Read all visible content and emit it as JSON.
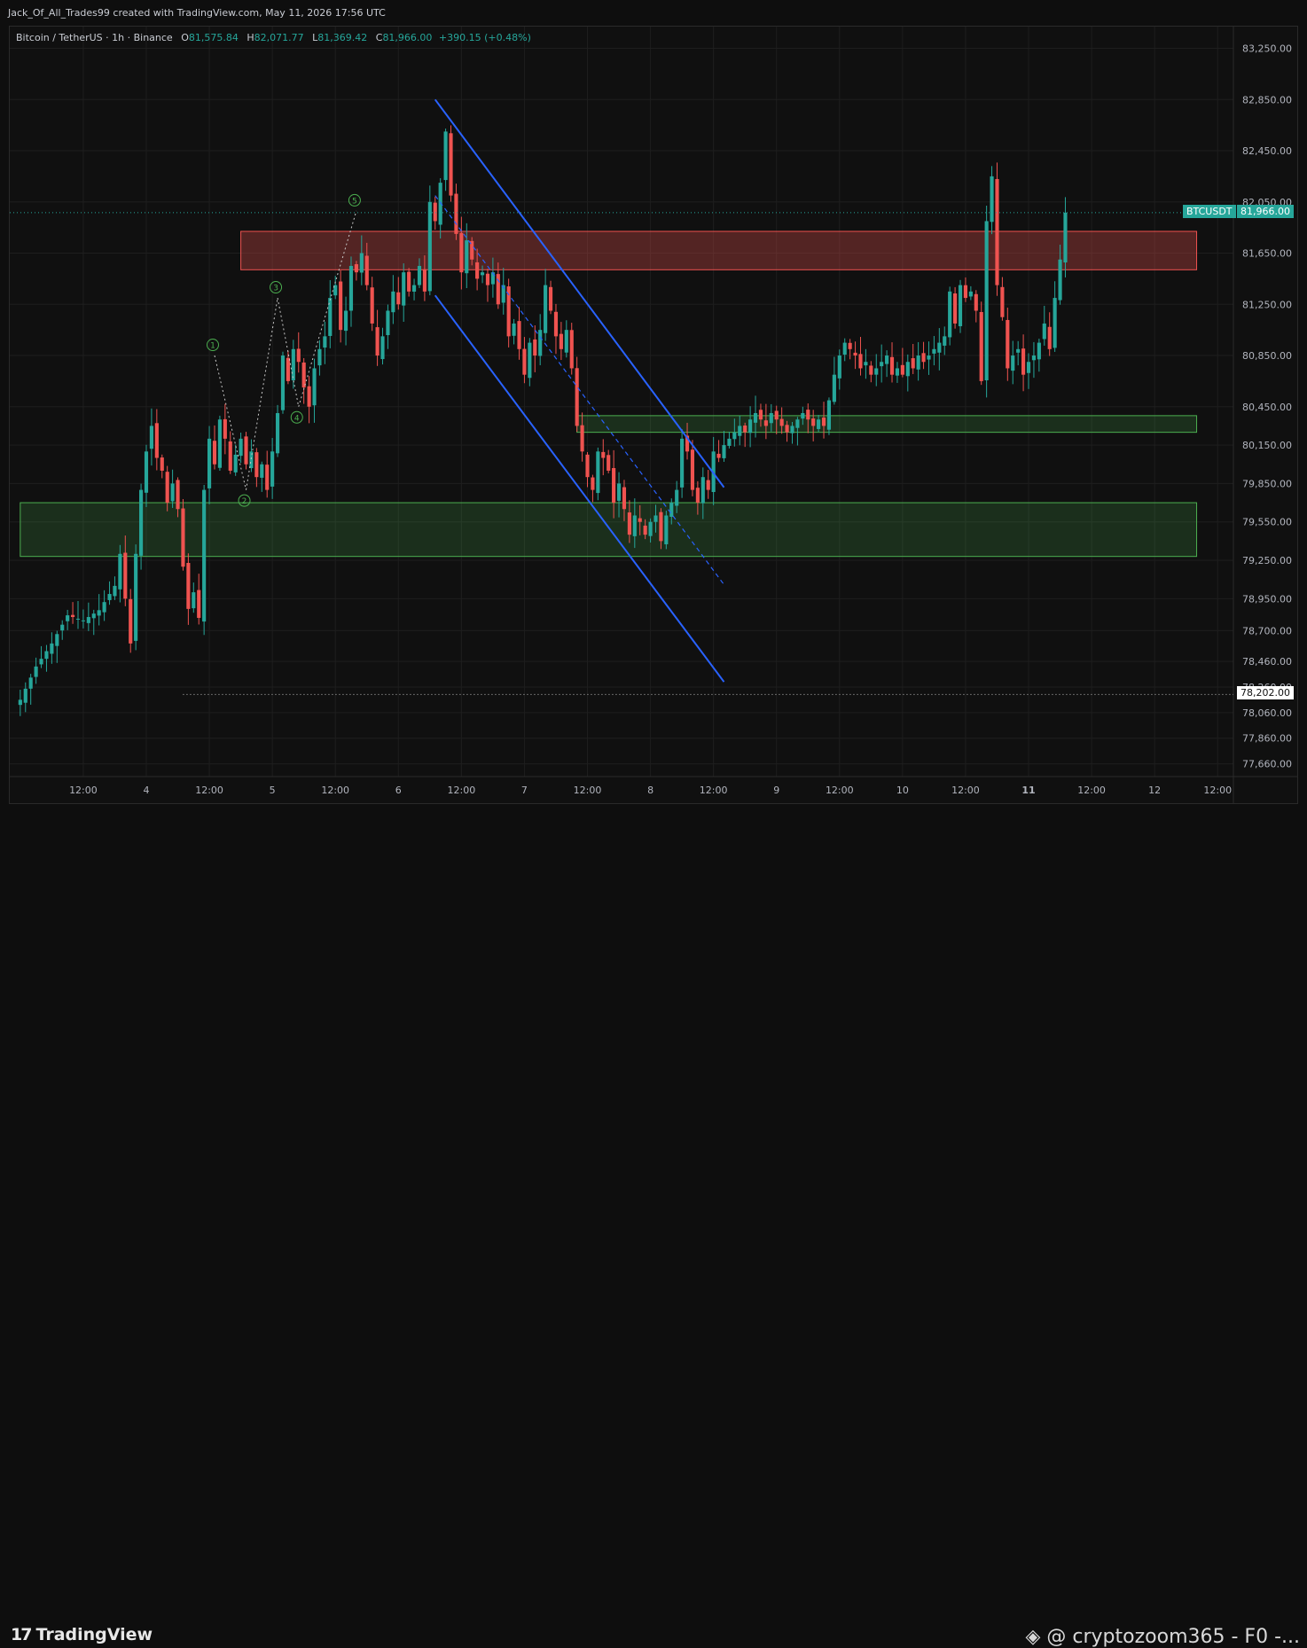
{
  "attribution": "Jack_Of_All_Trades99 created with TradingView.com, May 11, 2026 17:56 UTC",
  "legend": {
    "symbol": "Bitcoin / TetherUS · 1h · Binance",
    "open_label": "O",
    "open": "81,575.84",
    "high_label": "H",
    "high": "82,071.77",
    "low_label": "L",
    "low": "81,369.42",
    "close_label": "C",
    "close": "81,966.00",
    "change": "+390.15 (+0.48%)"
  },
  "price_tag": {
    "symbol": "BTCUSDT",
    "price": "81,966.00"
  },
  "low_tag": "78,202.00",
  "footer": {
    "brand": "TradingView",
    "watermark": "@ cryptozoom365 - F0 -..."
  },
  "colors": {
    "up": "#26a69a",
    "down": "#ef5350",
    "background": "#101010",
    "resistance_zone": "#ef5350",
    "support_zone": "#4caf50",
    "channel": "#2962ff"
  },
  "chart_data": {
    "type": "candlestick",
    "symbol": "Bitcoin / TetherUS",
    "timeframe": "1h",
    "exchange": "Binance",
    "y_ticks": [
      83250,
      82850,
      82450,
      82050,
      81650,
      81250,
      80850,
      80450,
      80150,
      79850,
      79550,
      79250,
      78950,
      78700,
      78460,
      78260,
      78060,
      77860,
      77660
    ],
    "y_tick_labels": [
      "83,250.00",
      "82,850.00",
      "82,450.00",
      "82,050.00",
      "81,650.00",
      "81,250.00",
      "80,850.00",
      "80,450.00",
      "80,150.00",
      "79,850.00",
      "79,550.00",
      "79,250.00",
      "78,950.00",
      "78,700.00",
      "78,460.00",
      "78,260.00",
      "78,060.00",
      "77,860.00",
      "77,660.00"
    ],
    "x_ticks": [
      {
        "t": 12,
        "label": "12:00"
      },
      {
        "t": 24,
        "label": "4"
      },
      {
        "t": 36,
        "label": "12:00"
      },
      {
        "t": 48,
        "label": "5"
      },
      {
        "t": 60,
        "label": "12:00"
      },
      {
        "t": 72,
        "label": "6"
      },
      {
        "t": 84,
        "label": "12:00"
      },
      {
        "t": 96,
        "label": "7"
      },
      {
        "t": 108,
        "label": "12:00"
      },
      {
        "t": 120,
        "label": "8"
      },
      {
        "t": 132,
        "label": "12:00"
      },
      {
        "t": 144,
        "label": "9"
      },
      {
        "t": 156,
        "label": "12:00"
      },
      {
        "t": 168,
        "label": "10"
      },
      {
        "t": 180,
        "label": "12:00"
      },
      {
        "t": 192,
        "label": "11"
      },
      {
        "t": 204,
        "label": "12:00"
      },
      {
        "t": 216,
        "label": "12"
      },
      {
        "t": 228,
        "label": "12:00"
      }
    ],
    "x_unit": "hours since May 3, 2026 00:00 UTC",
    "price_path": [
      [
        0,
        78160
      ],
      [
        3,
        78420
      ],
      [
        6,
        78600
      ],
      [
        9,
        78820
      ],
      [
        12,
        78780
      ],
      [
        15,
        78860
      ],
      [
        18,
        79050
      ],
      [
        19,
        79300
      ],
      [
        20,
        78950
      ],
      [
        21,
        78600
      ],
      [
        22,
        79300
      ],
      [
        23,
        79800
      ],
      [
        24,
        80100
      ],
      [
        25,
        80300
      ],
      [
        26,
        80050
      ],
      [
        27,
        79950
      ],
      [
        28,
        79700
      ],
      [
        29,
        79850
      ],
      [
        30,
        79650
      ],
      [
        31,
        79200
      ],
      [
        32,
        78870
      ],
      [
        33,
        79000
      ],
      [
        34,
        78800
      ],
      [
        35,
        79800
      ],
      [
        36,
        80200
      ],
      [
        37,
        80000
      ],
      [
        38,
        80350
      ],
      [
        39,
        80200
      ],
      [
        40,
        79950
      ],
      [
        42,
        80200
      ],
      [
        43,
        80000
      ],
      [
        44,
        80100
      ],
      [
        45,
        79900
      ],
      [
        46,
        80000
      ],
      [
        47,
        79800
      ],
      [
        48,
        80100
      ],
      [
        49,
        80400
      ],
      [
        50,
        80850
      ],
      [
        51,
        80650
      ],
      [
        52,
        80900
      ],
      [
        53,
        80800
      ],
      [
        54,
        80600
      ],
      [
        55,
        80450
      ],
      [
        56,
        80750
      ],
      [
        57,
        80900
      ],
      [
        58,
        81000
      ],
      [
        59,
        81300
      ],
      [
        60,
        81400
      ],
      [
        61,
        81050
      ],
      [
        62,
        81200
      ],
      [
        63,
        81550
      ],
      [
        64,
        81500
      ],
      [
        65,
        81650
      ],
      [
        66,
        81400
      ],
      [
        67,
        81100
      ],
      [
        68,
        80850
      ],
      [
        69,
        81000
      ],
      [
        70,
        81200
      ],
      [
        71,
        81350
      ],
      [
        72,
        81250
      ],
      [
        73,
        81500
      ],
      [
        74,
        81350
      ],
      [
        75,
        81400
      ],
      [
        76,
        81550
      ],
      [
        77,
        81350
      ],
      [
        78,
        82050
      ],
      [
        79,
        81900
      ],
      [
        80,
        82200
      ],
      [
        81,
        82600
      ],
      [
        82,
        82100
      ],
      [
        83,
        81800
      ],
      [
        84,
        81500
      ],
      [
        85,
        81750
      ],
      [
        86,
        81600
      ],
      [
        87,
        81450
      ],
      [
        88,
        81500
      ],
      [
        89,
        81400
      ],
      [
        90,
        81500
      ],
      [
        91,
        81250
      ],
      [
        92,
        81400
      ],
      [
        93,
        81000
      ],
      [
        94,
        81100
      ],
      [
        95,
        80900
      ],
      [
        96,
        80700
      ],
      [
        97,
        80950
      ],
      [
        98,
        80850
      ],
      [
        99,
        81050
      ],
      [
        100,
        81400
      ],
      [
        101,
        81200
      ],
      [
        102,
        81000
      ],
      [
        103,
        80900
      ],
      [
        104,
        81050
      ],
      [
        105,
        80750
      ],
      [
        106,
        80300
      ],
      [
        107,
        80100
      ],
      [
        108,
        79900
      ],
      [
        109,
        79800
      ],
      [
        110,
        80100
      ],
      [
        111,
        80050
      ],
      [
        112,
        79950
      ],
      [
        113,
        79700
      ],
      [
        114,
        79850
      ],
      [
        115,
        79650
      ],
      [
        116,
        79450
      ],
      [
        117,
        79600
      ],
      [
        118,
        79550
      ],
      [
        119,
        79450
      ],
      [
        120,
        79550
      ],
      [
        121,
        79600
      ],
      [
        122,
        79400
      ],
      [
        123,
        79600
      ],
      [
        124,
        79700
      ],
      [
        125,
        79800
      ],
      [
        126,
        80200
      ],
      [
        127,
        80100
      ],
      [
        128,
        79800
      ],
      [
        129,
        79700
      ],
      [
        130,
        79900
      ],
      [
        131,
        79800
      ],
      [
        132,
        80100
      ],
      [
        133,
        80050
      ],
      [
        134,
        80150
      ],
      [
        135,
        80200
      ],
      [
        136,
        80250
      ],
      [
        137,
        80300
      ],
      [
        138,
        80250
      ],
      [
        139,
        80350
      ],
      [
        140,
        80400
      ],
      [
        141,
        80350
      ],
      [
        142,
        80300
      ],
      [
        143,
        80400
      ],
      [
        144,
        80350
      ],
      [
        145,
        80300
      ],
      [
        146,
        80250
      ],
      [
        147,
        80300
      ],
      [
        148,
        80350
      ],
      [
        149,
        80400
      ],
      [
        150,
        80350
      ],
      [
        151,
        80300
      ],
      [
        152,
        80350
      ],
      [
        153,
        80300
      ],
      [
        154,
        80500
      ],
      [
        155,
        80700
      ],
      [
        156,
        80850
      ],
      [
        157,
        80950
      ],
      [
        158,
        80900
      ],
      [
        159,
        80850
      ],
      [
        160,
        80750
      ],
      [
        161,
        80800
      ],
      [
        162,
        80700
      ],
      [
        163,
        80750
      ],
      [
        164,
        80800
      ],
      [
        165,
        80850
      ],
      [
        166,
        80700
      ],
      [
        167,
        80750
      ],
      [
        168,
        80700
      ],
      [
        169,
        80800
      ],
      [
        170,
        80750
      ],
      [
        171,
        80850
      ],
      [
        172,
        80800
      ],
      [
        173,
        80850
      ],
      [
        174,
        80900
      ],
      [
        175,
        80950
      ],
      [
        176,
        81000
      ],
      [
        177,
        81350
      ],
      [
        178,
        81100
      ],
      [
        179,
        81400
      ],
      [
        180,
        81300
      ],
      [
        181,
        81350
      ],
      [
        182,
        81200
      ],
      [
        183,
        80650
      ],
      [
        184,
        81900
      ],
      [
        185,
        82250
      ],
      [
        186,
        81400
      ],
      [
        187,
        81150
      ],
      [
        188,
        80750
      ],
      [
        189,
        80850
      ],
      [
        190,
        80900
      ],
      [
        191,
        80700
      ],
      [
        192,
        80800
      ],
      [
        193,
        80850
      ],
      [
        194,
        80950
      ],
      [
        195,
        81100
      ],
      [
        196,
        80900
      ],
      [
        197,
        81300
      ],
      [
        198,
        81600
      ],
      [
        199,
        81966
      ]
    ],
    "zones": [
      {
        "name": "resistance",
        "t0": 42,
        "t1": 224,
        "top": 81820,
        "bottom": 81520
      },
      {
        "name": "support-minor",
        "t0": 106,
        "t1": 224,
        "top": 80380,
        "bottom": 80250
      },
      {
        "name": "support-major",
        "t0": 0,
        "t1": 224,
        "top": 79700,
        "bottom": 79280
      }
    ],
    "channel": {
      "upper": [
        [
          79,
          82850
        ],
        [
          134,
          79820
        ]
      ],
      "lower": [
        [
          79,
          81320
        ],
        [
          134,
          78300
        ]
      ],
      "mid": [
        [
          79,
          82100
        ],
        [
          134,
          79060
        ]
      ]
    },
    "wave_labels": [
      "1",
      "2",
      "3",
      "4",
      "5"
    ],
    "wave_points": [
      [
        37,
        80850
      ],
      [
        43,
        79800
      ],
      [
        49,
        81300
      ],
      [
        53,
        80450
      ],
      [
        64,
        81980
      ]
    ],
    "low_level": {
      "t0": 31,
      "t1": 228,
      "price": 78202
    },
    "current_price": 81966
  }
}
